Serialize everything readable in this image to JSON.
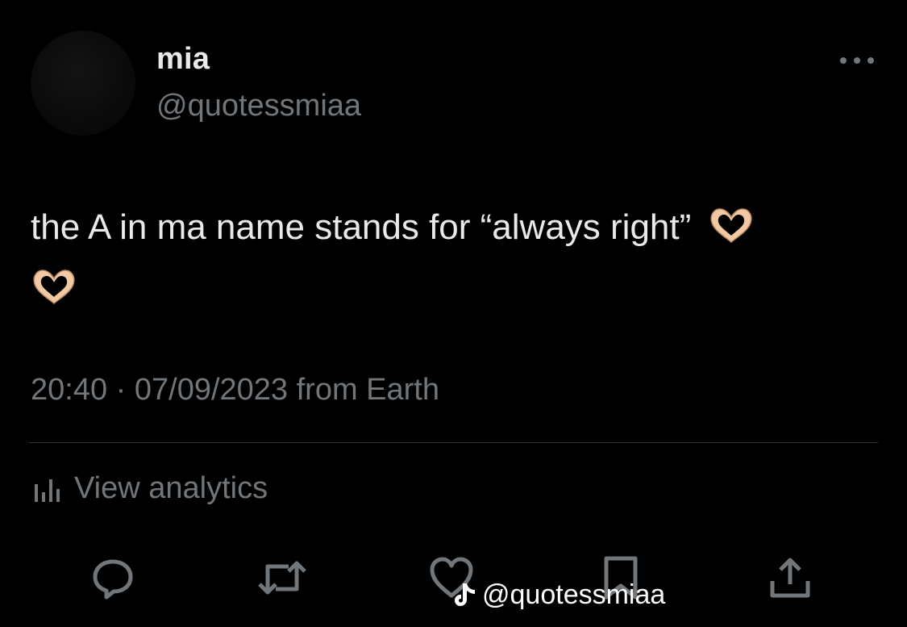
{
  "tweet": {
    "display_name": "mia",
    "handle": "@quotessmiaa",
    "text": "the A in ma name stands for “always right”",
    "timestamp": "20:40 · 07/09/2023 from Earth",
    "analytics_label": "View analytics",
    "emoji": "heart-hands"
  },
  "actions": [
    "reply-icon",
    "retweet-icon",
    "like-icon",
    "bookmark-icon",
    "share-icon"
  ],
  "watermark": {
    "platform_icon": "tiktok-icon",
    "text": "@quotessmiaa"
  },
  "colors": {
    "background": "#000000",
    "primary_text": "#e7e9ea",
    "secondary_text": "#71767b",
    "divider": "#2f3336"
  }
}
